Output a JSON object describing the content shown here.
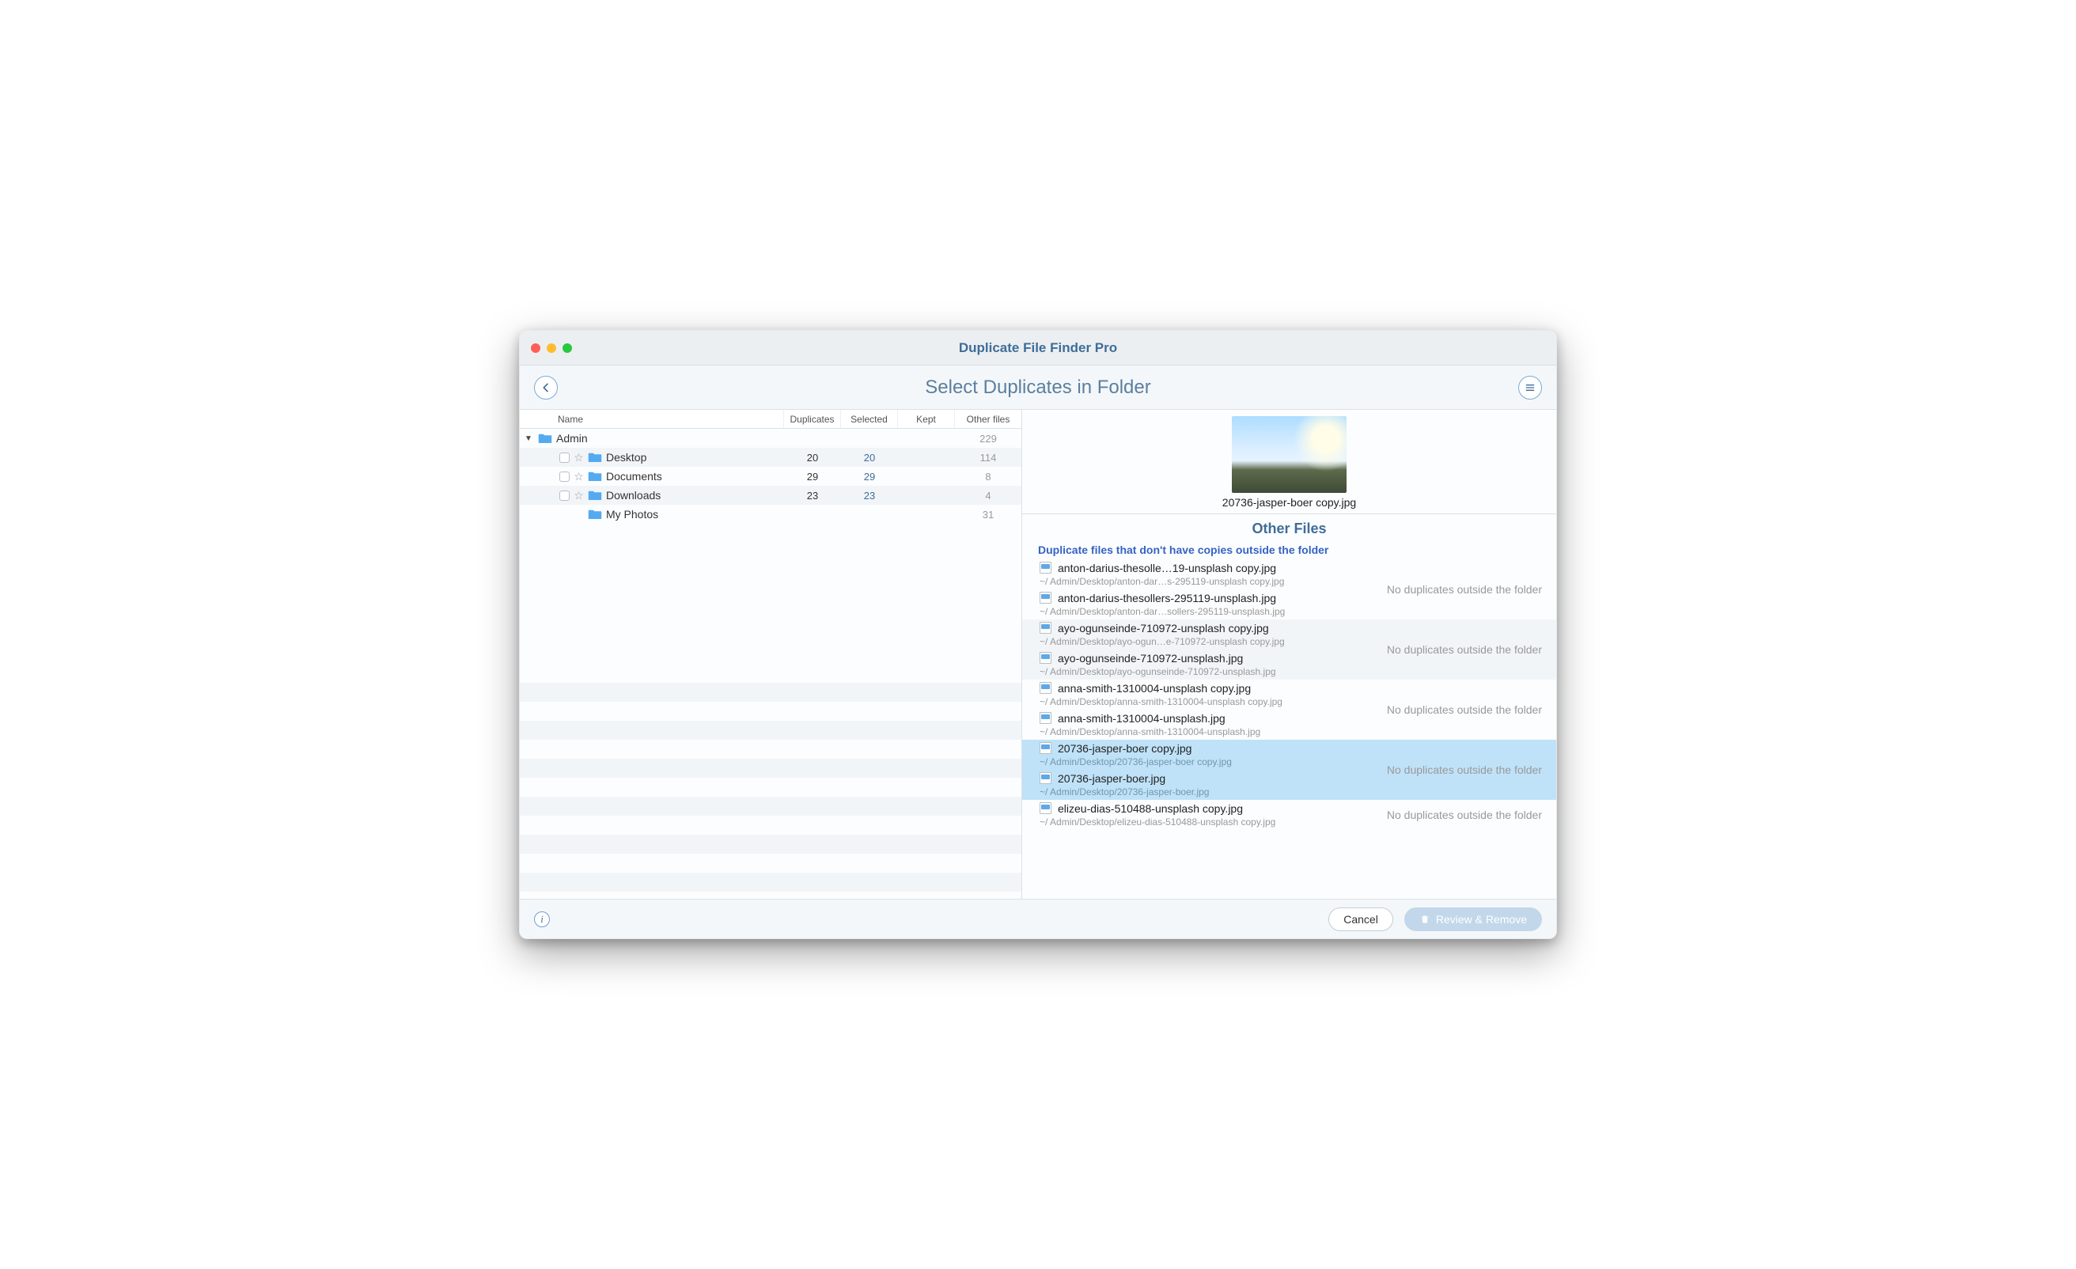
{
  "titlebar": {
    "title": "Duplicate File Finder Pro"
  },
  "subheader": {
    "title": "Select Duplicates in Folder"
  },
  "columns": {
    "name": "Name",
    "duplicates": "Duplicates",
    "selected": "Selected",
    "kept": "Kept",
    "other": "Other files"
  },
  "tree": [
    {
      "level": 0,
      "expanded": true,
      "checkbox": false,
      "star": false,
      "name": "Admin",
      "duplicates": "",
      "selected": "",
      "kept": "",
      "other": "229"
    },
    {
      "level": 1,
      "expanded": false,
      "checkbox": true,
      "star": true,
      "name": "Desktop",
      "duplicates": "20",
      "selected": "20",
      "kept": "",
      "other": "114"
    },
    {
      "level": 1,
      "expanded": false,
      "checkbox": true,
      "star": true,
      "name": "Documents",
      "duplicates": "29",
      "selected": "29",
      "kept": "",
      "other": "8"
    },
    {
      "level": 1,
      "expanded": false,
      "checkbox": true,
      "star": true,
      "name": "Downloads",
      "duplicates": "23",
      "selected": "23",
      "kept": "",
      "other": "4"
    },
    {
      "level": 1,
      "expanded": false,
      "checkbox": false,
      "star": false,
      "name": "My Photos",
      "duplicates": "",
      "selected": "",
      "kept": "",
      "other": "31"
    }
  ],
  "preview": {
    "filename": "20736-jasper-boer copy.jpg"
  },
  "otherFiles": {
    "title": "Other Files",
    "subtitle": "Duplicate files that don't have copies outside the folder",
    "noDupMsg": "No duplicates outside the folder",
    "groups": [
      {
        "selected": false,
        "files": [
          {
            "name": "anton-darius-thesolle…19-unsplash copy.jpg",
            "path": "~/ Admin/Desktop/anton-dar…s-295119-unsplash copy.jpg"
          },
          {
            "name": "anton-darius-thesollers-295119-unsplash.jpg",
            "path": "~/ Admin/Desktop/anton-dar…sollers-295119-unsplash.jpg"
          }
        ]
      },
      {
        "selected": false,
        "files": [
          {
            "name": "ayo-ogunseinde-710972-unsplash copy.jpg",
            "path": "~/ Admin/Desktop/ayo-ogun…e-710972-unsplash copy.jpg"
          },
          {
            "name": "ayo-ogunseinde-710972-unsplash.jpg",
            "path": "~/ Admin/Desktop/ayo-ogunseinde-710972-unsplash.jpg"
          }
        ]
      },
      {
        "selected": false,
        "files": [
          {
            "name": "anna-smith-1310004-unsplash copy.jpg",
            "path": "~/ Admin/Desktop/anna-smith-1310004-unsplash copy.jpg"
          },
          {
            "name": "anna-smith-1310004-unsplash.jpg",
            "path": "~/ Admin/Desktop/anna-smith-1310004-unsplash.jpg"
          }
        ]
      },
      {
        "selected": true,
        "files": [
          {
            "name": "20736-jasper-boer copy.jpg",
            "path": "~/ Admin/Desktop/20736-jasper-boer copy.jpg"
          },
          {
            "name": "20736-jasper-boer.jpg",
            "path": "~/ Admin/Desktop/20736-jasper-boer.jpg"
          }
        ]
      },
      {
        "selected": false,
        "files": [
          {
            "name": "elizeu-dias-510488-unsplash copy.jpg",
            "path": "~/ Admin/Desktop/elizeu-dias-510488-unsplash copy.jpg"
          }
        ]
      }
    ]
  },
  "bottombar": {
    "cancel": "Cancel",
    "review": "Review & Remove"
  }
}
